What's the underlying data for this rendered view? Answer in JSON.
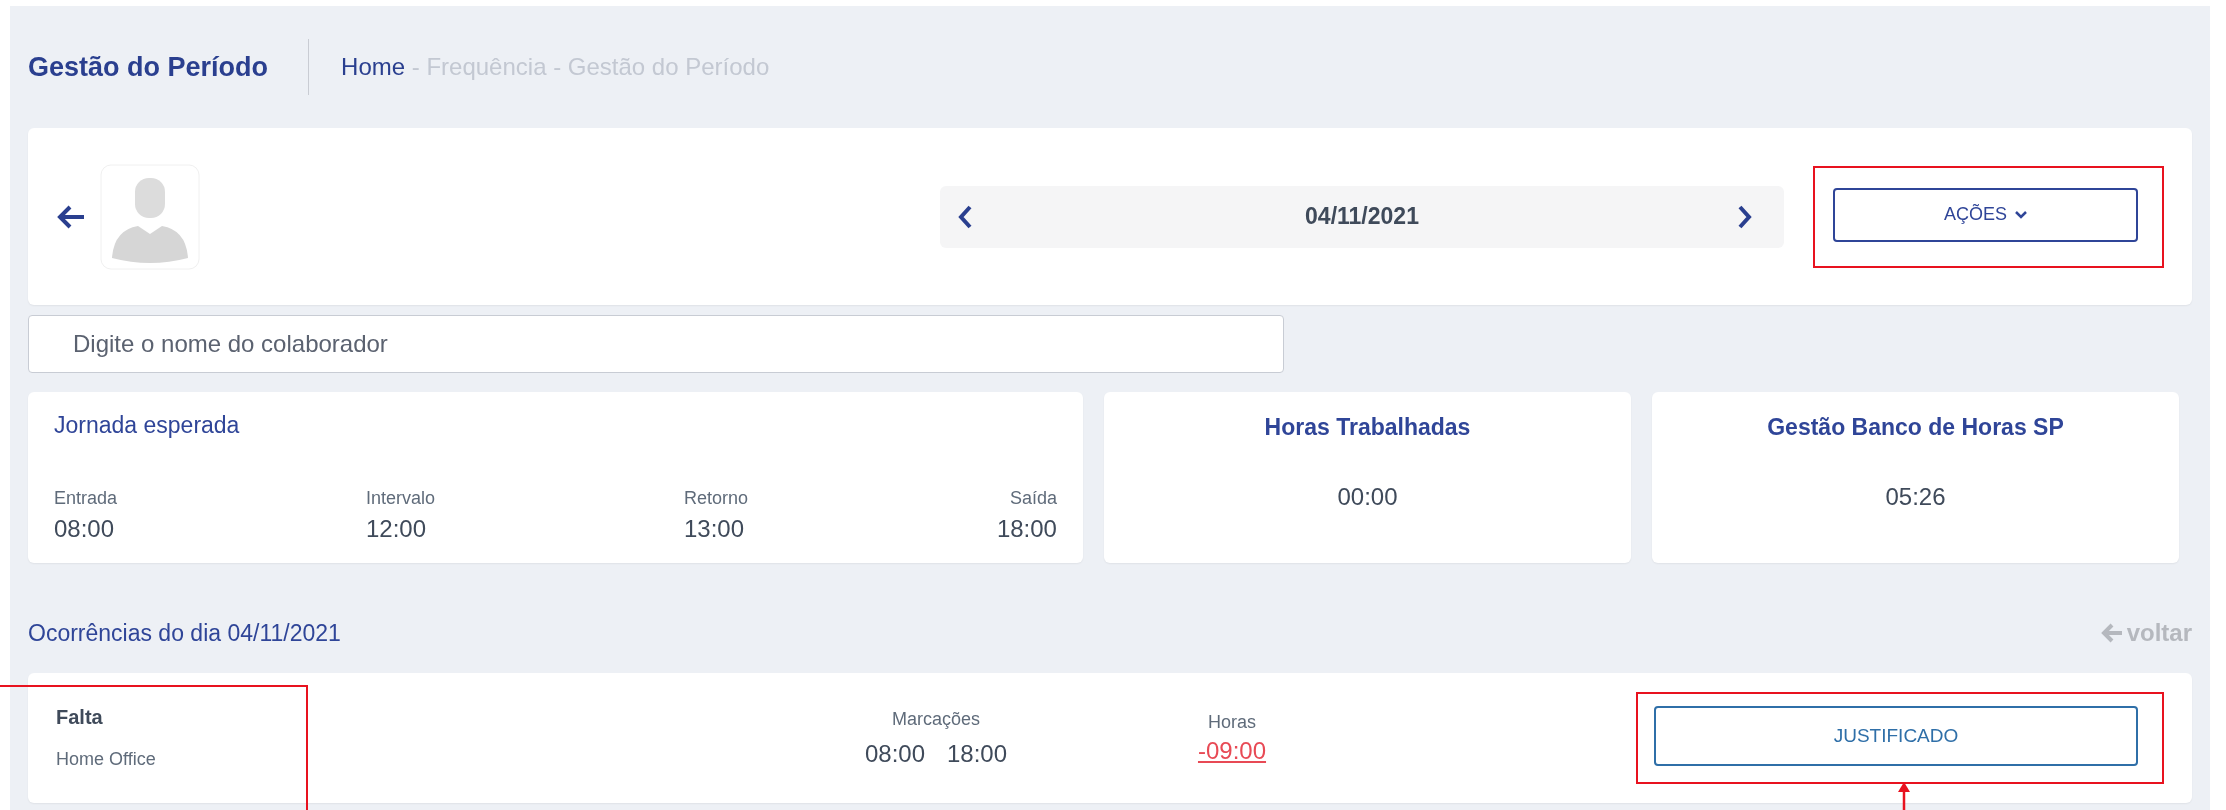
{
  "header": {
    "title": "Gestão do Período",
    "breadcrumb": [
      {
        "label": "Home",
        "current": false
      },
      {
        "label": "Frequência",
        "current": true
      },
      {
        "label": "Gestão do Período",
        "current": true
      }
    ],
    "separator": " - "
  },
  "toolbar": {
    "date": "04/11/2021",
    "actions": {
      "label": "AÇÕES",
      "highlighted": true
    }
  },
  "search": {
    "placeholder": "Digite o nome do colaborador"
  },
  "schedule": {
    "title": "Jornada esperada",
    "items": [
      {
        "label": "Entrada",
        "value": "08:00"
      },
      {
        "label": "Intervalo",
        "value": "12:00"
      },
      {
        "label": "Retorno",
        "value": "13:00"
      },
      {
        "label": "Saída",
        "value": "18:00"
      }
    ]
  },
  "summary_cards": [
    {
      "title": "Horas Trabalhadas",
      "value": "00:00"
    },
    {
      "title": "Gestão Banco de Horas SP",
      "value": "05:26"
    }
  ],
  "occurrences": {
    "title": "Ocorrências do dia 04/11/2021",
    "back_link": "voltar",
    "items": [
      {
        "type": "Falta",
        "detail": "Home Office",
        "info_highlighted": true,
        "marks_label": "Marcações",
        "marks": [
          "08:00",
          "18:00"
        ],
        "hours_label": "Horas",
        "hours": "-09:00",
        "negative": true,
        "status": "JUSTIFICADO",
        "status_highlighted": true
      }
    ]
  }
}
